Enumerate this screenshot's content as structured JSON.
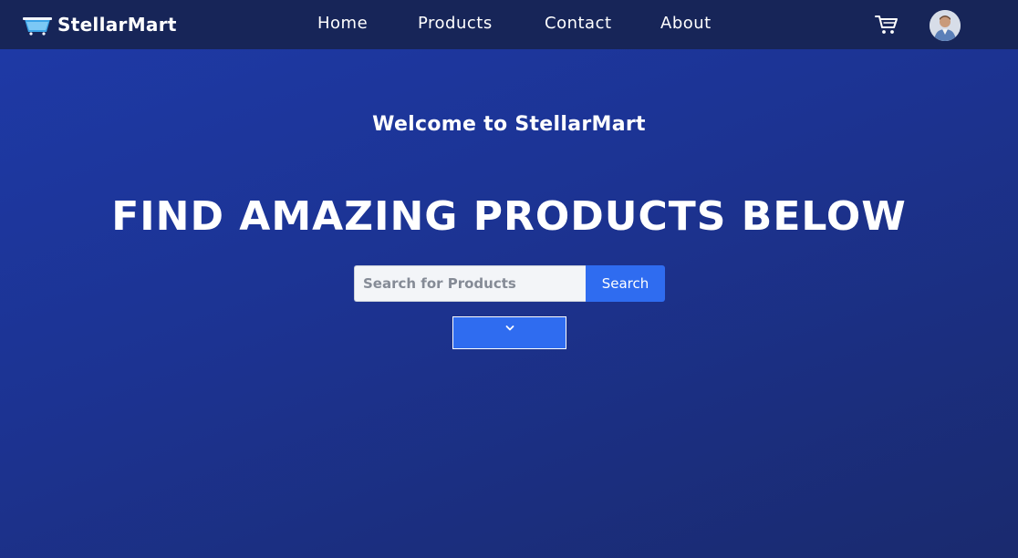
{
  "brand": {
    "name": "StellarMart",
    "icon": "basket-icon"
  },
  "nav": {
    "links": [
      {
        "label": "Home"
      },
      {
        "label": "Products"
      },
      {
        "label": "Contact"
      },
      {
        "label": "About"
      }
    ],
    "cart_icon": "cart-icon",
    "avatar": "user-avatar"
  },
  "hero": {
    "welcome": "Welcome to StellarMart",
    "headline": "FIND AMAZING PRODUCTS BELOW"
  },
  "search": {
    "placeholder": "Search for Products",
    "value": "",
    "button_label": "Search"
  },
  "dropdown": {
    "icon": "chevron-down-icon"
  },
  "colors": {
    "navbar": "#172558",
    "background_start": "#1e3aa8",
    "background_end": "#1a2a6e",
    "accent": "#2f6cf0",
    "text": "#ffffff"
  }
}
